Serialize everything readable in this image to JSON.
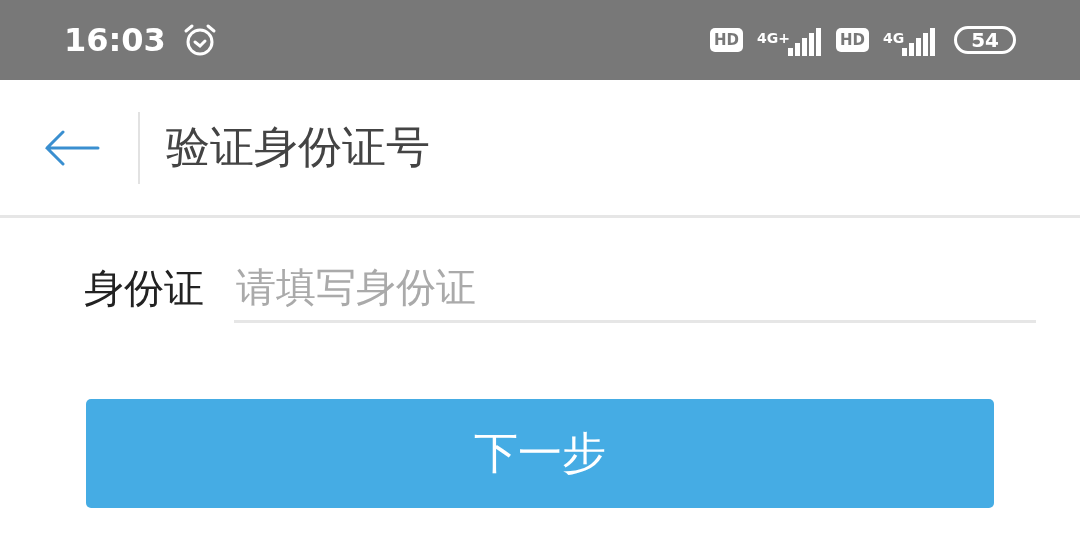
{
  "status_bar": {
    "time": "16:03",
    "sims": [
      {
        "hd": "HD",
        "network": "4G+"
      },
      {
        "hd": "HD",
        "network": "4G"
      }
    ],
    "battery": "54"
  },
  "header": {
    "title": "验证身份证号"
  },
  "form": {
    "label": "身份证",
    "placeholder": "请填写身份证"
  },
  "button": "下一步"
}
